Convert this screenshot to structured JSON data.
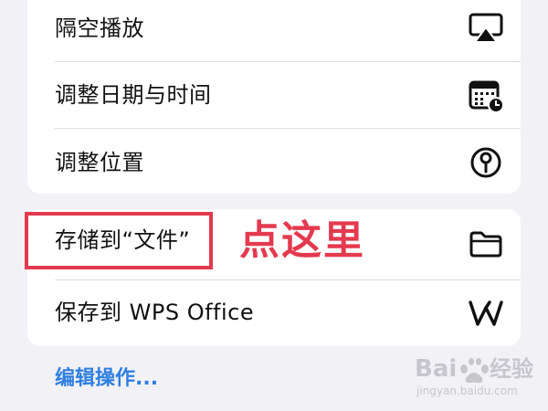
{
  "menu": {
    "top_items": [
      {
        "label": "隔空播放",
        "icon": "airplay-icon"
      },
      {
        "label": "调整日期与时间",
        "icon": "calendar-clock-icon"
      },
      {
        "label": "调整位置",
        "icon": "location-pin-icon"
      }
    ],
    "bottom_items": [
      {
        "label": "存储到“文件”",
        "icon": "folder-icon"
      },
      {
        "label": "保存到 WPS Office",
        "icon": "wps-office-icon"
      }
    ],
    "edit_actions_label": "编辑操作..."
  },
  "annotation": {
    "text": "点这里",
    "color": "#e43a4f"
  },
  "watermark": {
    "logo_text": "Baidu 经验",
    "url_text": "jingyan.baidu.com"
  },
  "colors": {
    "background": "#f2f2f6",
    "card": "#ffffff",
    "link": "#2f7fe0",
    "highlight": "#e43a4f"
  }
}
